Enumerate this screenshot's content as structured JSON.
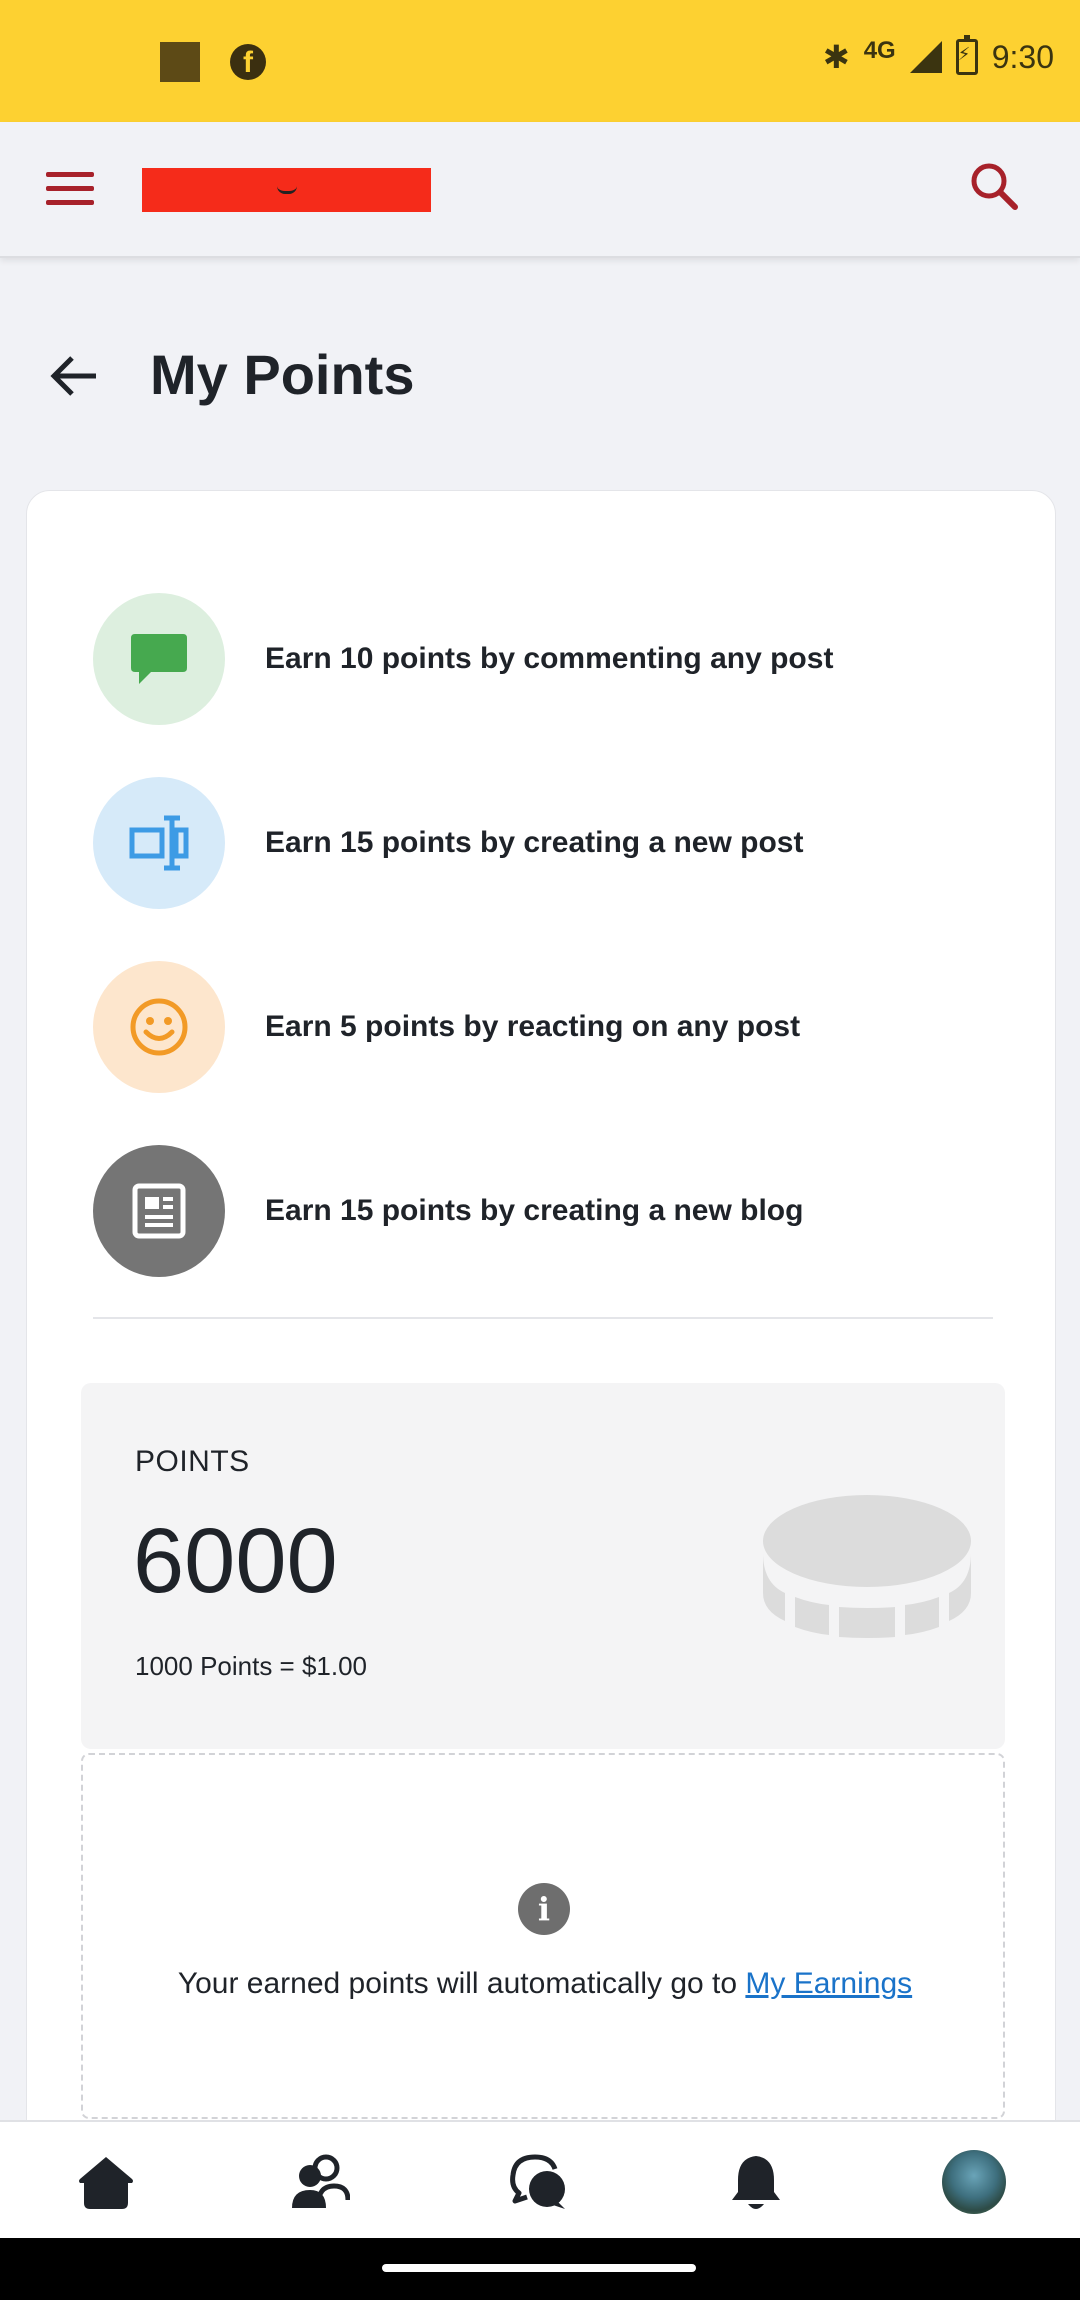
{
  "status_bar": {
    "network": "4G",
    "time": "9:30"
  },
  "page": {
    "title": "My Points"
  },
  "earn_items": [
    {
      "text": "Earn 10 points by commenting any post",
      "icon": "comment-icon",
      "bg": "#ddefdf",
      "fg": "#46a94f"
    },
    {
      "text": "Earn 15 points by creating a new post",
      "icon": "post-edit-icon",
      "bg": "#d6eaf9",
      "fg": "#3d9be5"
    },
    {
      "text": "Earn 5 points by reacting on any post",
      "icon": "smiley-icon",
      "bg": "#fde6cd",
      "fg": "#f29a26"
    },
    {
      "text": "Earn 15 points by creating a new blog",
      "icon": "blog-icon",
      "bg": "#757575",
      "fg": "#ffffff"
    }
  ],
  "points": {
    "label": "POINTS",
    "value": "6000",
    "rate": "1000 Points = $1.00"
  },
  "info": {
    "text": "Your earned points will automatically go to ",
    "link": "My Earnings"
  },
  "colors": {
    "status_bar": "#fdd131",
    "accent": "#a7212a",
    "logo": "#f52b1a",
    "link": "#1a73c9"
  },
  "nav": [
    "home-icon",
    "friends-icon",
    "chat-icon",
    "bell-icon",
    "avatar"
  ]
}
